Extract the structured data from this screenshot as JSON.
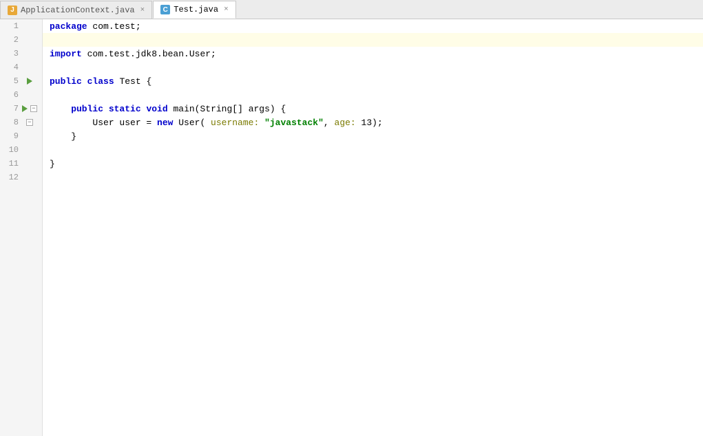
{
  "tabs": [
    {
      "id": "application-context",
      "label": "ApplicationContext.java",
      "icon_type": "orange",
      "icon_letter": "J",
      "active": false,
      "closeable": true
    },
    {
      "id": "test-java",
      "label": "Test.java",
      "icon_type": "blue",
      "icon_letter": "C",
      "active": true,
      "closeable": true
    }
  ],
  "lines": [
    {
      "num": 1,
      "tokens": [
        {
          "t": "kw",
          "v": "package"
        },
        {
          "t": "normal",
          "v": " com.test;"
        }
      ],
      "gutter": ""
    },
    {
      "num": 2,
      "tokens": [],
      "gutter": "",
      "highlighted": true
    },
    {
      "num": 3,
      "tokens": [
        {
          "t": "kw",
          "v": "import"
        },
        {
          "t": "normal",
          "v": " com.test.jdk8.bean.User;"
        }
      ],
      "gutter": ""
    },
    {
      "num": 4,
      "tokens": [],
      "gutter": ""
    },
    {
      "num": 5,
      "tokens": [
        {
          "t": "kw",
          "v": "public"
        },
        {
          "t": "normal",
          "v": " "
        },
        {
          "t": "kw",
          "v": "class"
        },
        {
          "t": "normal",
          "v": " Test {"
        }
      ],
      "gutter": "run"
    },
    {
      "num": 6,
      "tokens": [],
      "gutter": ""
    },
    {
      "num": 7,
      "tokens": [
        {
          "t": "kw",
          "v": "    public"
        },
        {
          "t": "normal",
          "v": " "
        },
        {
          "t": "kw",
          "v": "static"
        },
        {
          "t": "normal",
          "v": " "
        },
        {
          "t": "kw",
          "v": "void"
        },
        {
          "t": "normal",
          "v": " main(String[] args) {"
        }
      ],
      "gutter": "run-fold"
    },
    {
      "num": 8,
      "tokens": [
        {
          "t": "normal",
          "v": "        User user = "
        },
        {
          "t": "kw",
          "v": "new"
        },
        {
          "t": "normal",
          "v": " User( "
        },
        {
          "t": "named-param",
          "v": "username:"
        },
        {
          "t": "normal",
          "v": " "
        },
        {
          "t": "string",
          "v": "\"javastack\""
        },
        {
          "t": "normal",
          "v": ", "
        },
        {
          "t": "named-param",
          "v": "age:"
        },
        {
          "t": "normal",
          "v": " 13);"
        }
      ],
      "gutter": "fold-close"
    },
    {
      "num": 9,
      "tokens": [
        {
          "t": "normal",
          "v": "    }"
        }
      ],
      "gutter": ""
    },
    {
      "num": 10,
      "tokens": [],
      "gutter": ""
    },
    {
      "num": 11,
      "tokens": [
        {
          "t": "normal",
          "v": "}"
        }
      ],
      "gutter": ""
    },
    {
      "num": 12,
      "tokens": [],
      "gutter": ""
    }
  ]
}
